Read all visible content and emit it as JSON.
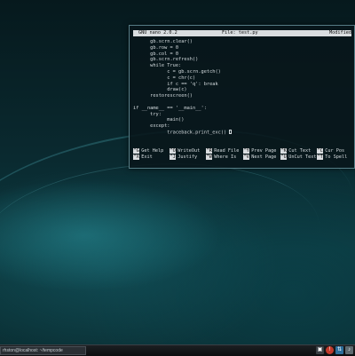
{
  "editor": {
    "app": "GNU nano 2.0.2",
    "file": "File: test.py",
    "status": "Modified",
    "lines": [
      "      gb.scrn.clear()",
      "      gb.row = 0",
      "      gb.col = 0",
      "      gb.scrn.refresh()",
      "      while True:",
      "            c = gb.scrn.getch()",
      "            c = chr(c)",
      "            if c == 'q': break",
      "            draw(c)",
      "      restorescreen()",
      "",
      "if __name__ == '__main__':",
      "      try:",
      "            main()",
      "      except:",
      "            traceback.print_exc()"
    ]
  },
  "shortcuts": [
    [
      {
        "key": "^G",
        "label": "Get Help"
      },
      {
        "key": "^O",
        "label": "WriteOut"
      },
      {
        "key": "^R",
        "label": "Read File"
      },
      {
        "key": "^Y",
        "label": "Prev Page"
      },
      {
        "key": "^K",
        "label": "Cut Text"
      },
      {
        "key": "^C",
        "label": "Cur Pos"
      }
    ],
    [
      {
        "key": "^X",
        "label": "Exit"
      },
      {
        "key": "^J",
        "label": "Justify"
      },
      {
        "key": "^W",
        "label": "Where Is"
      },
      {
        "key": "^V",
        "label": "Next Page"
      },
      {
        "key": "^U",
        "label": "UnCut Text"
      },
      {
        "key": "^T",
        "label": "To Spell"
      }
    ]
  ],
  "taskbar": {
    "window_title": "rhston@localhost: ~/tempcode",
    "tray_icons": [
      "terminal-icon",
      "security-shield-icon",
      "network-icon",
      "volume-icon"
    ]
  }
}
